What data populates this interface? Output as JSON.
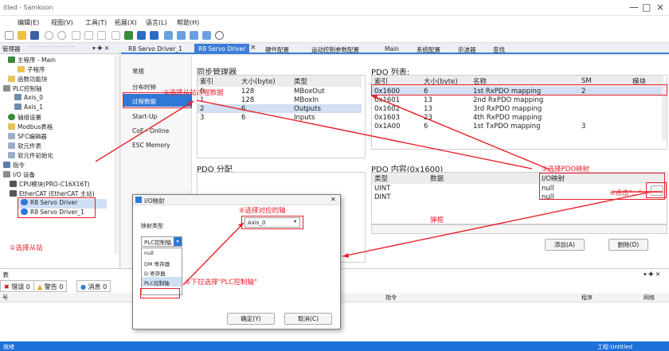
{
  "window": {
    "title": "itled - Samkoon",
    "minimize": "—",
    "maximize": "□",
    "close": "×"
  },
  "menu": [
    "编辑(E)",
    "视图(V)",
    "工具(T)",
    "拓展(X)",
    "语言(L)",
    "帮助(H)"
  ],
  "left_pane": {
    "header": "管理器",
    "header_fill": "···························",
    "pin": "▾ ✚ ✕",
    "items": [
      "主程序 - Main",
      "子程序",
      "函数功能块",
      "PLC控制轴",
      "Axis_0",
      "Axis_1",
      "轴组设置",
      "Modbus表格",
      "SFC编辑器",
      "软元件表",
      "软元件初始化",
      "指令",
      "I/O 设备",
      "CPU模块(PRO-C16X16T)",
      "EtherCAT (EtherCAT 主站)",
      "R8 Servo Driver",
      "R8 Servo Driver_1"
    ]
  },
  "tabs": [
    "R8 Servo Driver_1",
    "R8 Servo Driver",
    "×",
    "硬件配置",
    "运动控制参数配置",
    "Main",
    "系统配置",
    "示波器",
    "查找"
  ],
  "nav": {
    "items": [
      "常规",
      "分布时钟",
      "过程数据",
      "Start-Up",
      "CoE - Online",
      "ESC Memory"
    ],
    "selected": "过程数据"
  },
  "sync_manager": {
    "title": "同步管理器",
    "columns": [
      "索引",
      "大小(byte)",
      "类型"
    ],
    "rows": [
      [
        "0",
        "128",
        "MBoxOut"
      ],
      [
        "1",
        "128",
        "MBoxIn"
      ],
      [
        "2",
        "6",
        "Outputs"
      ],
      [
        "3",
        "6",
        "Inputs"
      ]
    ]
  },
  "pdo_list": {
    "title": "PDO 列表:",
    "columns": [
      "索引",
      "大小(byte)",
      "名称",
      "SM",
      "模块"
    ],
    "rows": [
      [
        "0x1600",
        "6",
        "1st RxPDO mapping",
        "2",
        ""
      ],
      [
        "0x1601",
        "13",
        "2nd RxPDO mapping",
        "",
        ""
      ],
      [
        "0x1602",
        "13",
        "3rd RxPDO mapping",
        "",
        ""
      ],
      [
        "0x1603",
        "23",
        "4th RxPDO mapping",
        "",
        ""
      ],
      [
        "0x1A00",
        "6",
        "1st TxPDO mapping",
        "3",
        ""
      ]
    ]
  },
  "pdo_assign": {
    "title": "PDO 分配"
  },
  "pdo_content": {
    "title": "PDO 内容(0x1600)",
    "columns": [
      "类型",
      "数据",
      "I/O映射"
    ],
    "rows": [
      [
        "UINT",
        "",
        "null"
      ],
      [
        "DINT",
        "",
        "null"
      ]
    ],
    "add_label": "添加(A)",
    "delete_label": "删除(D)",
    "ellipsis": "..."
  },
  "bottom": {
    "header": "表",
    "error_label": "错误 0",
    "warning_label": "警告 0",
    "info_label": "消息 0",
    "col_id": "号",
    "col_cmd": "指令",
    "col_prog": "程序",
    "col_net": "网络",
    "pin": "▾ ✚ ✕"
  },
  "status": {
    "left": "就绪",
    "right": "工程:Untitled"
  },
  "dialog": {
    "title": "I/O映射",
    "close": "✕",
    "mapping_type_label": "映射类型",
    "mapping_type_value": "PLC控制轴",
    "dropdown_options": [
      "null",
      "DM 寄存器",
      "D 寄存器",
      "PLC控制轴"
    ],
    "axis_value": "Axis_0",
    "ok_label": "确定(Y)",
    "cancel_label": "取消(C)"
  },
  "annotations": {
    "a1": "①选择从站",
    "a2": "②选择从站过程数据",
    "a3": "③选择PDO映射",
    "a4": "④点击\"...\"",
    "a5": "⑤下拉选择\"PLC控制轴\"",
    "a6": "⑥选择对应的轴",
    "popup": "弹框"
  },
  "colors": {
    "accent": "#3b7dd8",
    "annotation": "#e8202a",
    "status_bar": "#1e6fd9"
  }
}
